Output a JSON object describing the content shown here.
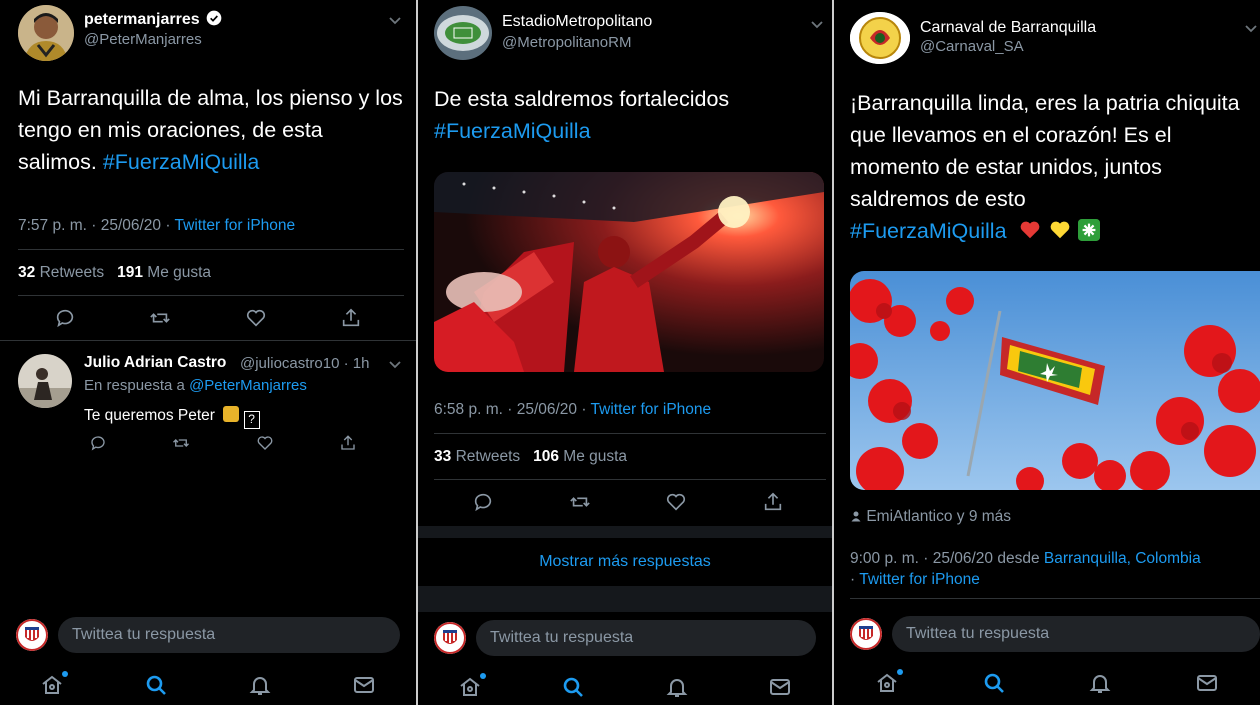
{
  "panel1": {
    "author": {
      "name": "petermanjarres",
      "handle": "@PeterManjarres"
    },
    "text": "Mi Barranquilla de alma, los pienso y los tengo en mis oraciones, de esta salimos.",
    "hashtag": "#FuerzaMiQuilla",
    "time": "7:57 p. m. · 25/06/20 · ",
    "source": "Twitter for iPhone",
    "retweets": "32",
    "retweets_label": "Retweets",
    "likes": "191",
    "likes_label": "Me gusta",
    "reply": {
      "name": "Julio Adrian Castro",
      "handle": "@juliocastro10 · 1h",
      "in_reply_prefix": "En respuesta a ",
      "in_reply_to": "@PeterManjarres",
      "text": "Te queremos Peter",
      "emoji_box": "?"
    },
    "reply_placeholder": "Twittea tu respuesta"
  },
  "panel2": {
    "author": {
      "name": "EstadioMetropolitano",
      "handle": "@MetropolitanoRM"
    },
    "text": "De esta saldremos fortalecidos",
    "hashtag": "#FuerzaMiQuilla",
    "time": "6:58 p. m. · 25/06/20 · ",
    "source": "Twitter for iPhone",
    "retweets": "33",
    "retweets_label": "Retweets",
    "likes": "106",
    "likes_label": "Me gusta",
    "more_replies": "Mostrar más respuestas",
    "reply_placeholder": "Twittea tu respuesta"
  },
  "panel3": {
    "author": {
      "name": "Carnaval de Barranquilla",
      "handle": "@Carnaval_SA"
    },
    "text": "¡Barranquilla linda, eres la patria chiquita que llevamos en el corazón! Es el momento de estar unidos, juntos saldremos de esto",
    "hashtag": "#FuerzaMiQuilla",
    "tagged": "EmiAtlantico y 9 más",
    "time_prefix": "9:00 p. m. · 25/06/20 desde ",
    "location": "Barranquilla, Colombia",
    "time_sep": " · ",
    "source": "Twitter for iPhone",
    "reply_placeholder": "Twittea tu respuesta"
  },
  "colors": {
    "accent": "#1d9bf0",
    "muted": "#8b98a5",
    "background": "#000000",
    "verified": "#ffffff"
  },
  "icons": [
    "verified-badge-icon",
    "chevron-down-icon",
    "reply-icon",
    "retweet-icon",
    "like-icon",
    "share-icon",
    "home-icon",
    "search-icon",
    "notifications-icon",
    "messages-icon",
    "person-icon"
  ]
}
